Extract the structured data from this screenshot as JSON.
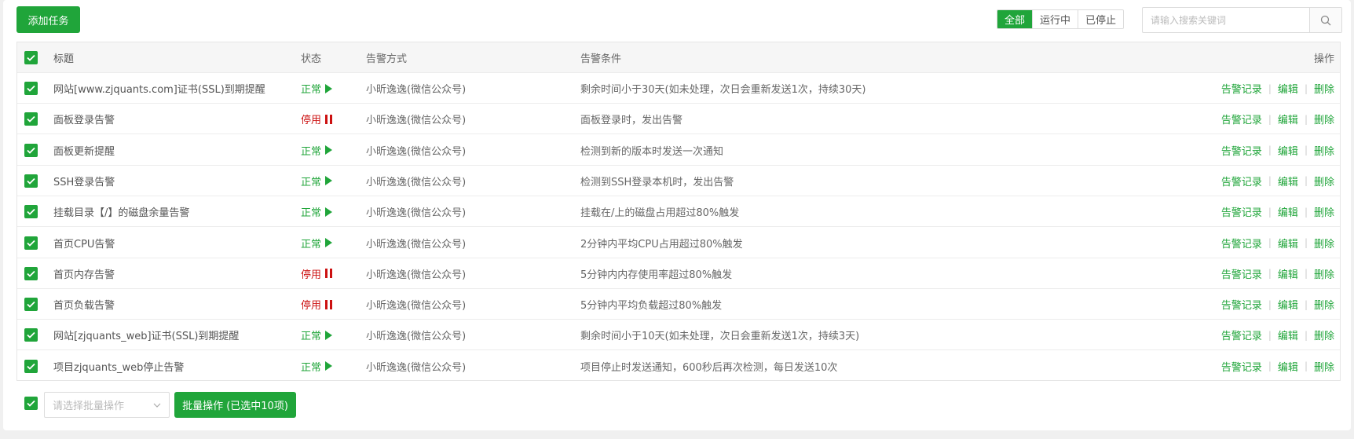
{
  "toolbar": {
    "add_label": "添加任务",
    "filters": [
      "全部",
      "运行中",
      "已停止"
    ],
    "search_placeholder": "请输入搜索关键词"
  },
  "table": {
    "headers": {
      "title": "标题",
      "status": "状态",
      "method": "告警方式",
      "condition": "告警条件",
      "ops": "操作"
    },
    "ops_labels": [
      "告警记录",
      "编辑",
      "删除"
    ],
    "rows": [
      {
        "title": "网站[www.zjquants.com]证书(SSL)到期提醒",
        "status": "正常",
        "state": "normal",
        "method": "小昕逸逸(微信公众号)",
        "condition": "剩余时间小于30天(如未处理，次日会重新发送1次，持续30天)"
      },
      {
        "title": "面板登录告警",
        "status": "停用",
        "state": "stop",
        "method": "小昕逸逸(微信公众号)",
        "condition": "面板登录时，发出告警"
      },
      {
        "title": "面板更新提醒",
        "status": "正常",
        "state": "normal",
        "method": "小昕逸逸(微信公众号)",
        "condition": "检测到新的版本时发送一次通知"
      },
      {
        "title": "SSH登录告警",
        "status": "正常",
        "state": "normal",
        "method": "小昕逸逸(微信公众号)",
        "condition": "检测到SSH登录本机时，发出告警"
      },
      {
        "title": "挂载目录【/】的磁盘余量告警",
        "status": "正常",
        "state": "normal",
        "method": "小昕逸逸(微信公众号)",
        "condition": "挂载在/上的磁盘占用超过80%触发"
      },
      {
        "title": "首页CPU告警",
        "status": "正常",
        "state": "normal",
        "method": "小昕逸逸(微信公众号)",
        "condition": "2分钟内平均CPU占用超过80%触发"
      },
      {
        "title": "首页内存告警",
        "status": "停用",
        "state": "stop",
        "method": "小昕逸逸(微信公众号)",
        "condition": "5分钟内内存使用率超过80%触发"
      },
      {
        "title": "首页负载告警",
        "status": "停用",
        "state": "stop",
        "method": "小昕逸逸(微信公众号)",
        "condition": "5分钟内平均负载超过80%触发"
      },
      {
        "title": "网站[zjquants_web]证书(SSL)到期提醒",
        "status": "正常",
        "state": "normal",
        "method": "小昕逸逸(微信公众号)",
        "condition": "剩余时间小于10天(如未处理，次日会重新发送1次，持续3天)"
      },
      {
        "title": "项目zjquants_web停止告警",
        "status": "正常",
        "state": "normal",
        "method": "小昕逸逸(微信公众号)",
        "condition": "项目停止时发送通知，600秒后再次检测，每日发送10次"
      }
    ]
  },
  "bottom": {
    "batch_placeholder": "请选择批量操作",
    "batch_button": "批量操作 (已选中10项)"
  },
  "colors": {
    "accent": "#20a53a",
    "stop": "#cc1111"
  }
}
